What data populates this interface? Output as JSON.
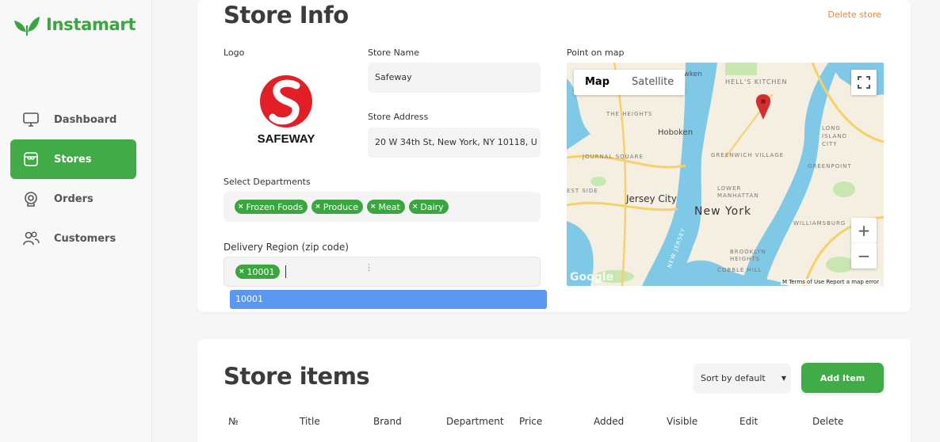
{
  "sidebar": {
    "brand": "Instamart",
    "items": [
      {
        "label": "Dashboard",
        "icon": "monitor-icon"
      },
      {
        "label": "Stores",
        "icon": "store-icon"
      },
      {
        "label": "Orders",
        "icon": "orders-icon"
      },
      {
        "label": "Customers",
        "icon": "users-icon"
      }
    ],
    "active": "Stores",
    "accent": "#41ab48"
  },
  "store_info": {
    "title": "Store Info",
    "delete_label": "Delete store",
    "logo_label": "Logo",
    "logo_text": "SAFEWAY",
    "store_name_label": "Store Name",
    "store_name_value": "Safeway",
    "store_address_label": "Store Address",
    "store_address_value": "20 W 34th St, New York, NY 10118, U",
    "departments_label": "Select Departments",
    "departments": [
      "Frozen Foods",
      "Produce",
      "Meat",
      "Dairy"
    ],
    "delivery_label": "Delivery Region (zip code)",
    "zip_codes": [
      "10001"
    ],
    "suggestion": "10001",
    "map_label": "Point on map"
  },
  "map": {
    "map_tab": "Map",
    "satellite_tab": "Satellite",
    "zoom_in": "+",
    "zoom_out": "−",
    "google": "Google",
    "attribution": "M  Terms of Use  Report a map error",
    "places": {
      "hoboken": "Hoboken",
      "jersey_city": "Jersey City",
      "new_york": "New York",
      "hells_kitchen": "HELL'S KITCHEN",
      "the_heights": "THE HEIGHTS",
      "journal_square": "JOURNAL SQUARE",
      "greenwich_village": "GREENWICH VILLAGE",
      "manhattan": "LOWER MANHATTAN",
      "greenpoint": "GREENPOINT",
      "long_island_city": "LONG ISLAND CITY",
      "williamsburg": "WILLIAMSBURG",
      "cobble_hill": "COBBLE HILL",
      "hawken": "awken",
      "est_side": "EST SIDE",
      "bklyn_heights": "BROOKLYN HEIGHTS",
      "new_jersey": "NEW JERSEY"
    }
  },
  "store_items": {
    "title": "Store items",
    "sort_label": "Sort by default",
    "add_label": "Add Item",
    "columns": [
      "№",
      "Title",
      "Brand",
      "Department",
      "Price",
      "Added",
      "Visible",
      "Edit",
      "Delete"
    ]
  }
}
